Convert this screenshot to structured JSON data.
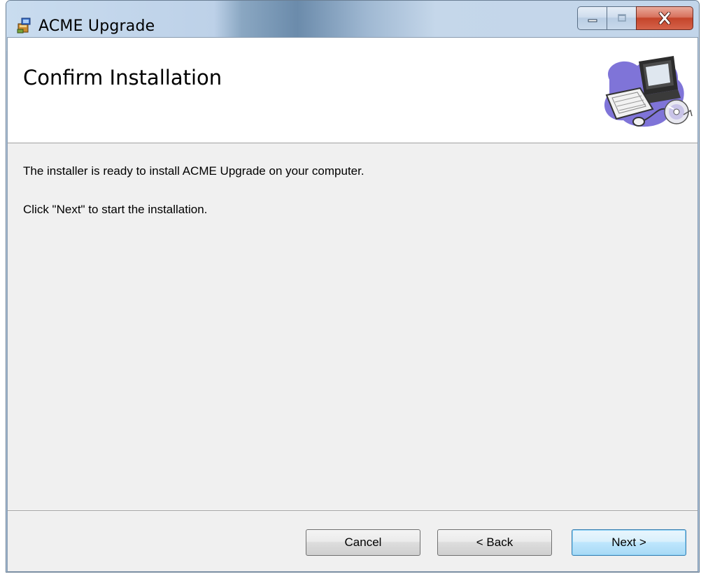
{
  "window": {
    "title": "ACME Upgrade",
    "controls": [
      "minimize-icon",
      "maximize-icon",
      "close-icon"
    ]
  },
  "banner": {
    "title": "Confirm Installation",
    "graphic": "computer-cd-icon"
  },
  "body": {
    "line1": "The installer is ready to install ACME Upgrade on your computer.",
    "line2": "Click \"Next\" to start the installation."
  },
  "buttons": {
    "cancel": "Cancel",
    "back": "< Back",
    "next": "Next >"
  },
  "colors": {
    "client_bg": "#f0f0f0",
    "banner_bg": "#ffffff",
    "close_button": "#c4442a",
    "default_button_border": "#3c7fb1"
  }
}
